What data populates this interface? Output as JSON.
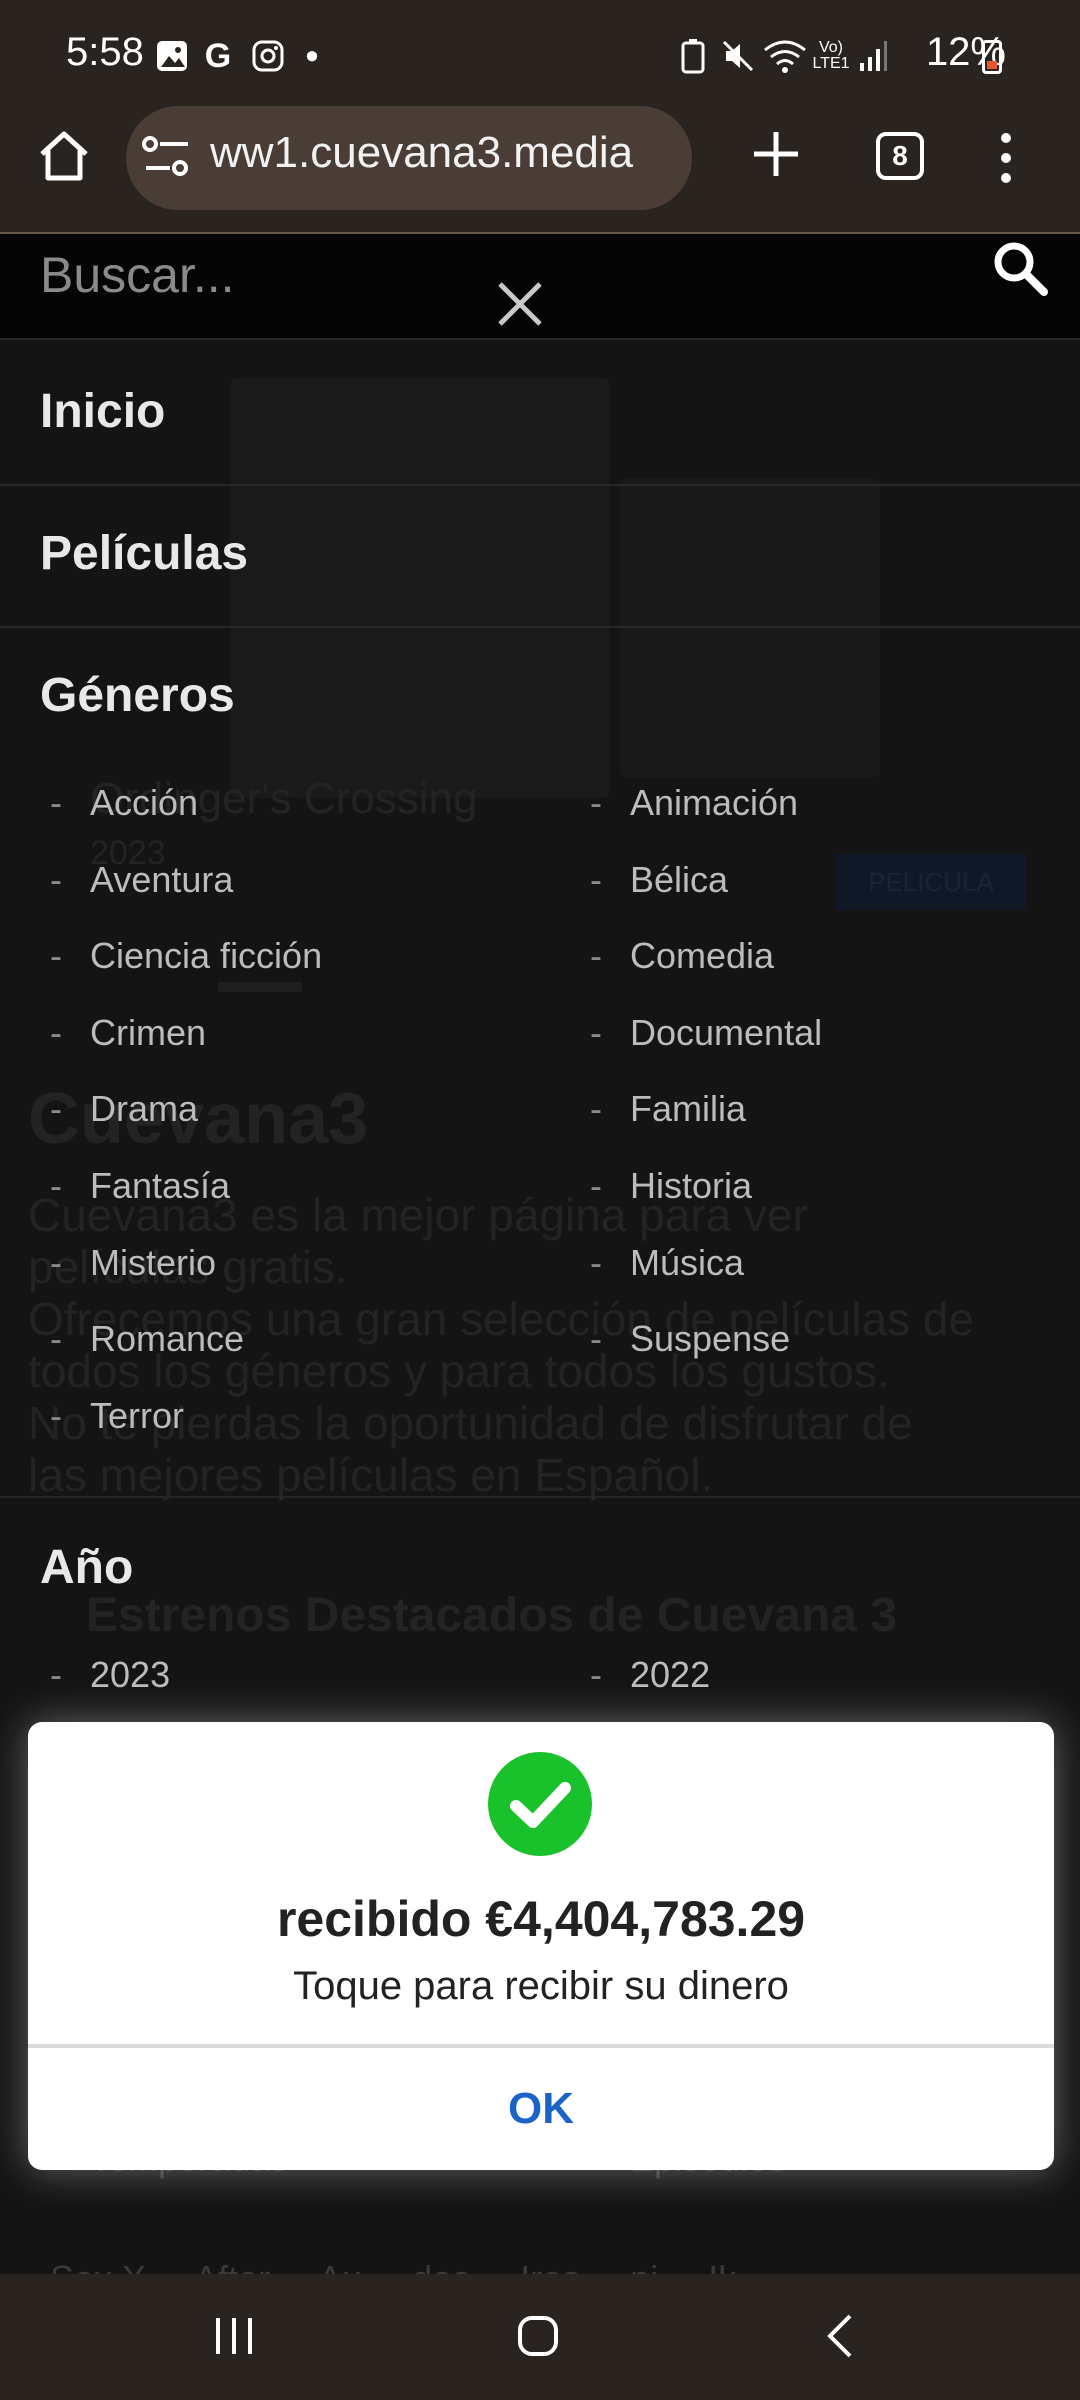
{
  "status": {
    "time": "5:58",
    "battery": "12%",
    "network": "Vo) LTE1"
  },
  "browser": {
    "url": "ww1.cuevana3.media",
    "tab_count": "8"
  },
  "search": {
    "placeholder": "Buscar..."
  },
  "menu": {
    "inicio": "Inicio",
    "peliculas": "Películas",
    "generos_title": "Géneros",
    "genres_left": [
      "Acción",
      "Aventura",
      "Ciencia ficción",
      "Crimen",
      "Drama",
      "Fantasía",
      "Misterio",
      "Romance",
      "Terror"
    ],
    "genres_right": [
      "Animación",
      "Bélica",
      "Comedia",
      "Documental",
      "Familia",
      "Historia",
      "Música",
      "Suspense"
    ],
    "year_title": "Año",
    "years": [
      "2023",
      "2022"
    ]
  },
  "background_page": {
    "movie_title": "Ordinger's Crossing",
    "movie_year": "2023",
    "badge": "PELICULA",
    "site_title": "Cuevana3",
    "desc1": "Cuevana3 es la mejor página para ver",
    "desc2": "películas gratis.",
    "desc3": "Ofrecemos una gran selección de películas de",
    "desc4": "todos los géneros y para todos los gustos.",
    "desc5": "No te pierdas la oportunidad de disfrutar de",
    "desc6": "las mejores películas en Español.",
    "section": "Estrenos Destacados de Cuevana 3",
    "left_label": "Temporadas",
    "right_label": "Episodios",
    "bottom_text": "Sex X ... After ... Au ... des ... Ires ... pi ... Ik ..."
  },
  "dialog": {
    "title": "recibido €4,404,783.29",
    "message": "Toque para recibir su dinero",
    "ok_label": "OK",
    "check_color": "#19c22a"
  }
}
